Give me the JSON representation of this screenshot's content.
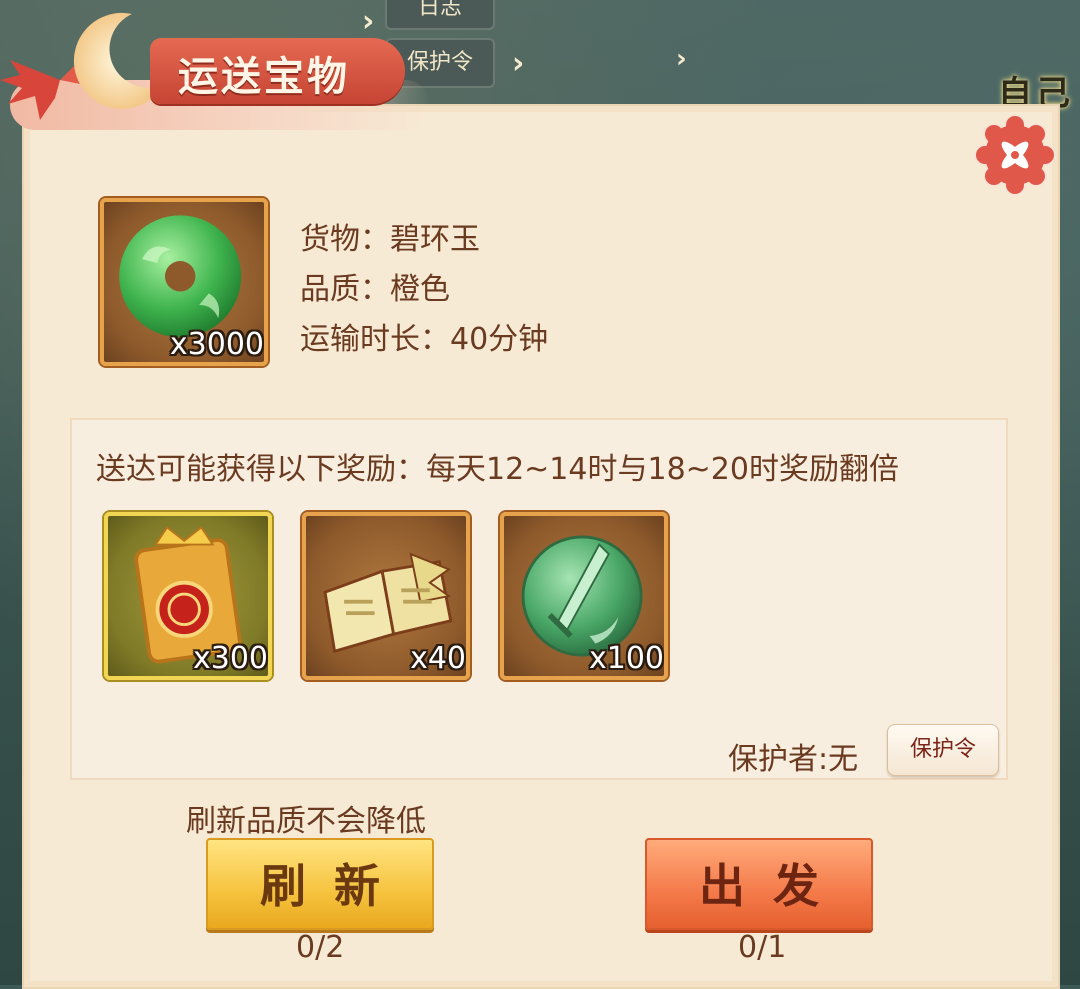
{
  "background": {
    "tab_top_label": "日志",
    "tab_protect_label": "保护令",
    "side_label": "自己"
  },
  "dialog": {
    "title": "运送宝物",
    "close_icon": "close-icon"
  },
  "cargo": {
    "icon": "jade-disc-icon",
    "quantity": "x3000",
    "goods_line": "货物：碧环玉",
    "quality_line": "品质：橙色",
    "duration_line": "运输时长：40分钟"
  },
  "rewards": {
    "title": "送达可能获得以下奖励：每天12~14时与18~20时奖励翻倍",
    "items": [
      {
        "icon": "transport-token-icon",
        "quantity": "x300",
        "frame": "gold"
      },
      {
        "icon": "skill-book-icon",
        "quantity": "x40",
        "frame": "orange"
      },
      {
        "icon": "jade-sword-medal-icon",
        "quantity": "x100",
        "frame": "orange"
      }
    ]
  },
  "protector": {
    "label": "保护者:无",
    "button_label": "保护令"
  },
  "actions": {
    "refresh_note": "刷新品质不会降低",
    "refresh_label": "刷新",
    "refresh_count": "0/2",
    "go_label": "出发",
    "go_count": "0/1"
  },
  "colors": {
    "panel_bg": "#f7ead5",
    "text_brown": "#6a3b20",
    "refresh_yellow": "#f6c33e",
    "go_orange": "#f47a4a",
    "title_red": "#c64434"
  }
}
